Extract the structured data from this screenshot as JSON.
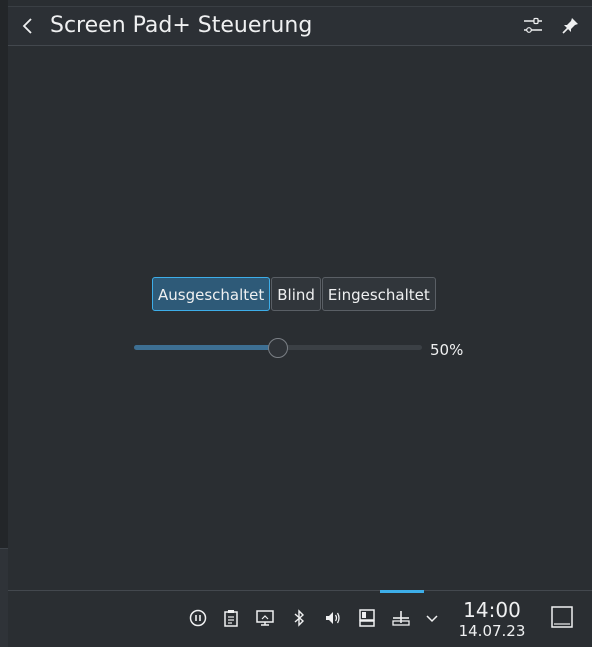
{
  "popup": {
    "title": "Screen Pad+ Steuerung",
    "modes": [
      {
        "label": "Ausgeschaltet",
        "active": true
      },
      {
        "label": "Blind",
        "active": false
      },
      {
        "label": "Eingeschaltet",
        "active": false
      }
    ],
    "brightness": {
      "value": 0.5,
      "label": "50%"
    }
  },
  "taskbar": {
    "tray_icons": [
      "media-pause-icon",
      "clipboard-icon",
      "display-icon",
      "bluetooth-icon",
      "volume-icon",
      "screenpad-icon",
      "network-icon",
      "chevron-down-icon"
    ],
    "clock": {
      "time": "14:00",
      "date": "14.07.23"
    }
  },
  "colors": {
    "accent": "#3daee9",
    "background": "#2a2e32",
    "active_button": "#2e5a78"
  }
}
